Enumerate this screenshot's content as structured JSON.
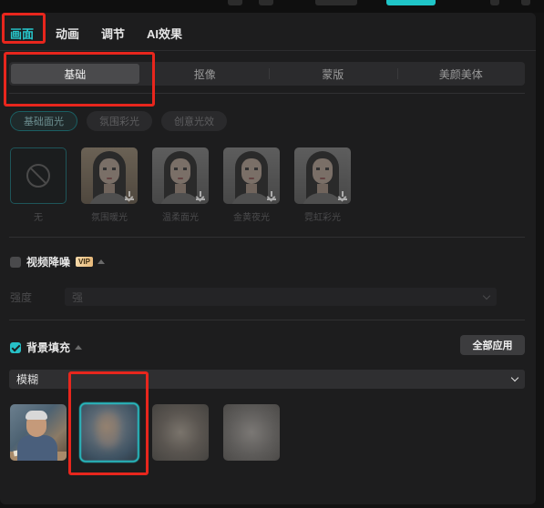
{
  "main_tabs": [
    {
      "label": "画面",
      "active": true
    },
    {
      "label": "动画",
      "active": false
    },
    {
      "label": "调节",
      "active": false
    },
    {
      "label": "AI效果",
      "active": false
    }
  ],
  "sub_tabs": [
    {
      "label": "基础",
      "active": true
    },
    {
      "label": "抠像",
      "active": false
    },
    {
      "label": "蒙版",
      "active": false
    },
    {
      "label": "美颜美体",
      "active": false
    }
  ],
  "light_pills": [
    {
      "label": "基础面光",
      "active": true
    },
    {
      "label": "氛围彩光",
      "active": false
    },
    {
      "label": "创意光效",
      "active": false
    }
  ],
  "light_effects": [
    {
      "label": "无",
      "icon": "none-icon"
    },
    {
      "label": "氛围暖光",
      "icon": "download-icon"
    },
    {
      "label": "温柔面光",
      "icon": "download-icon"
    },
    {
      "label": "金黄夜光",
      "icon": "download-icon"
    },
    {
      "label": "霓虹彩光",
      "icon": "download-icon"
    }
  ],
  "video_denoise": {
    "label": "视频降噪",
    "badge": "VIP",
    "checked": false,
    "strength_label": "强度",
    "strength_value": "强"
  },
  "background_fill": {
    "label": "背景填充",
    "checked": true,
    "apply_all_label": "全部应用",
    "mode_value": "模糊",
    "thumbnails": [
      {
        "kind": "original-photo",
        "selected": false
      },
      {
        "kind": "blur-level-1",
        "selected": true
      },
      {
        "kind": "blur-level-2",
        "selected": false
      },
      {
        "kind": "blur-level-3",
        "selected": false
      }
    ]
  },
  "colors": {
    "accent": "#27c7cc",
    "highlight": "#e8261d",
    "panel": "#1d1d1e"
  }
}
